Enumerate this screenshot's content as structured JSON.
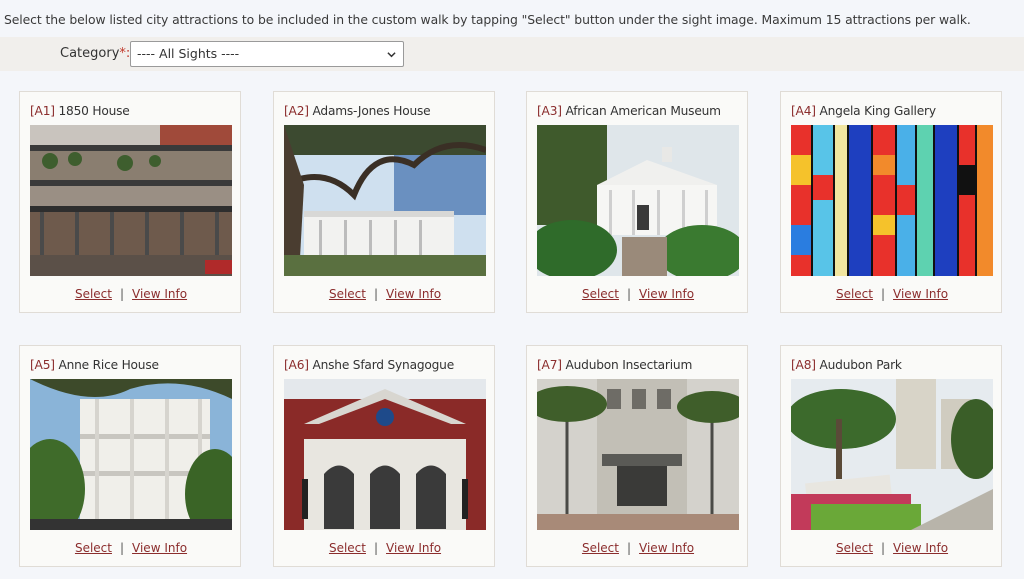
{
  "instructions": "Select the below listed city attractions to be included in the custom walk by tapping \"Select\" button under the sight image. Maximum 15 attractions per walk.",
  "filter": {
    "label": "Category",
    "required_mark": "*:",
    "selected": "---- All Sights ----"
  },
  "card_actions": {
    "select": "Select",
    "separator": "|",
    "view_info": "View Info"
  },
  "attractions": [
    {
      "code": "[A1]",
      "name": "1850 House"
    },
    {
      "code": "[A2]",
      "name": "Adams-Jones House"
    },
    {
      "code": "[A3]",
      "name": "African American Museum"
    },
    {
      "code": "[A4]",
      "name": "Angela King Gallery"
    },
    {
      "code": "[A5]",
      "name": "Anne Rice House"
    },
    {
      "code": "[A6]",
      "name": "Anshe Sfard Synagogue"
    },
    {
      "code": "[A7]",
      "name": "Audubon Insectarium"
    },
    {
      "code": "[A8]",
      "name": "Audubon Park"
    }
  ],
  "colors": {
    "accent": "#8b2d2d",
    "required": "#c0392b"
  }
}
